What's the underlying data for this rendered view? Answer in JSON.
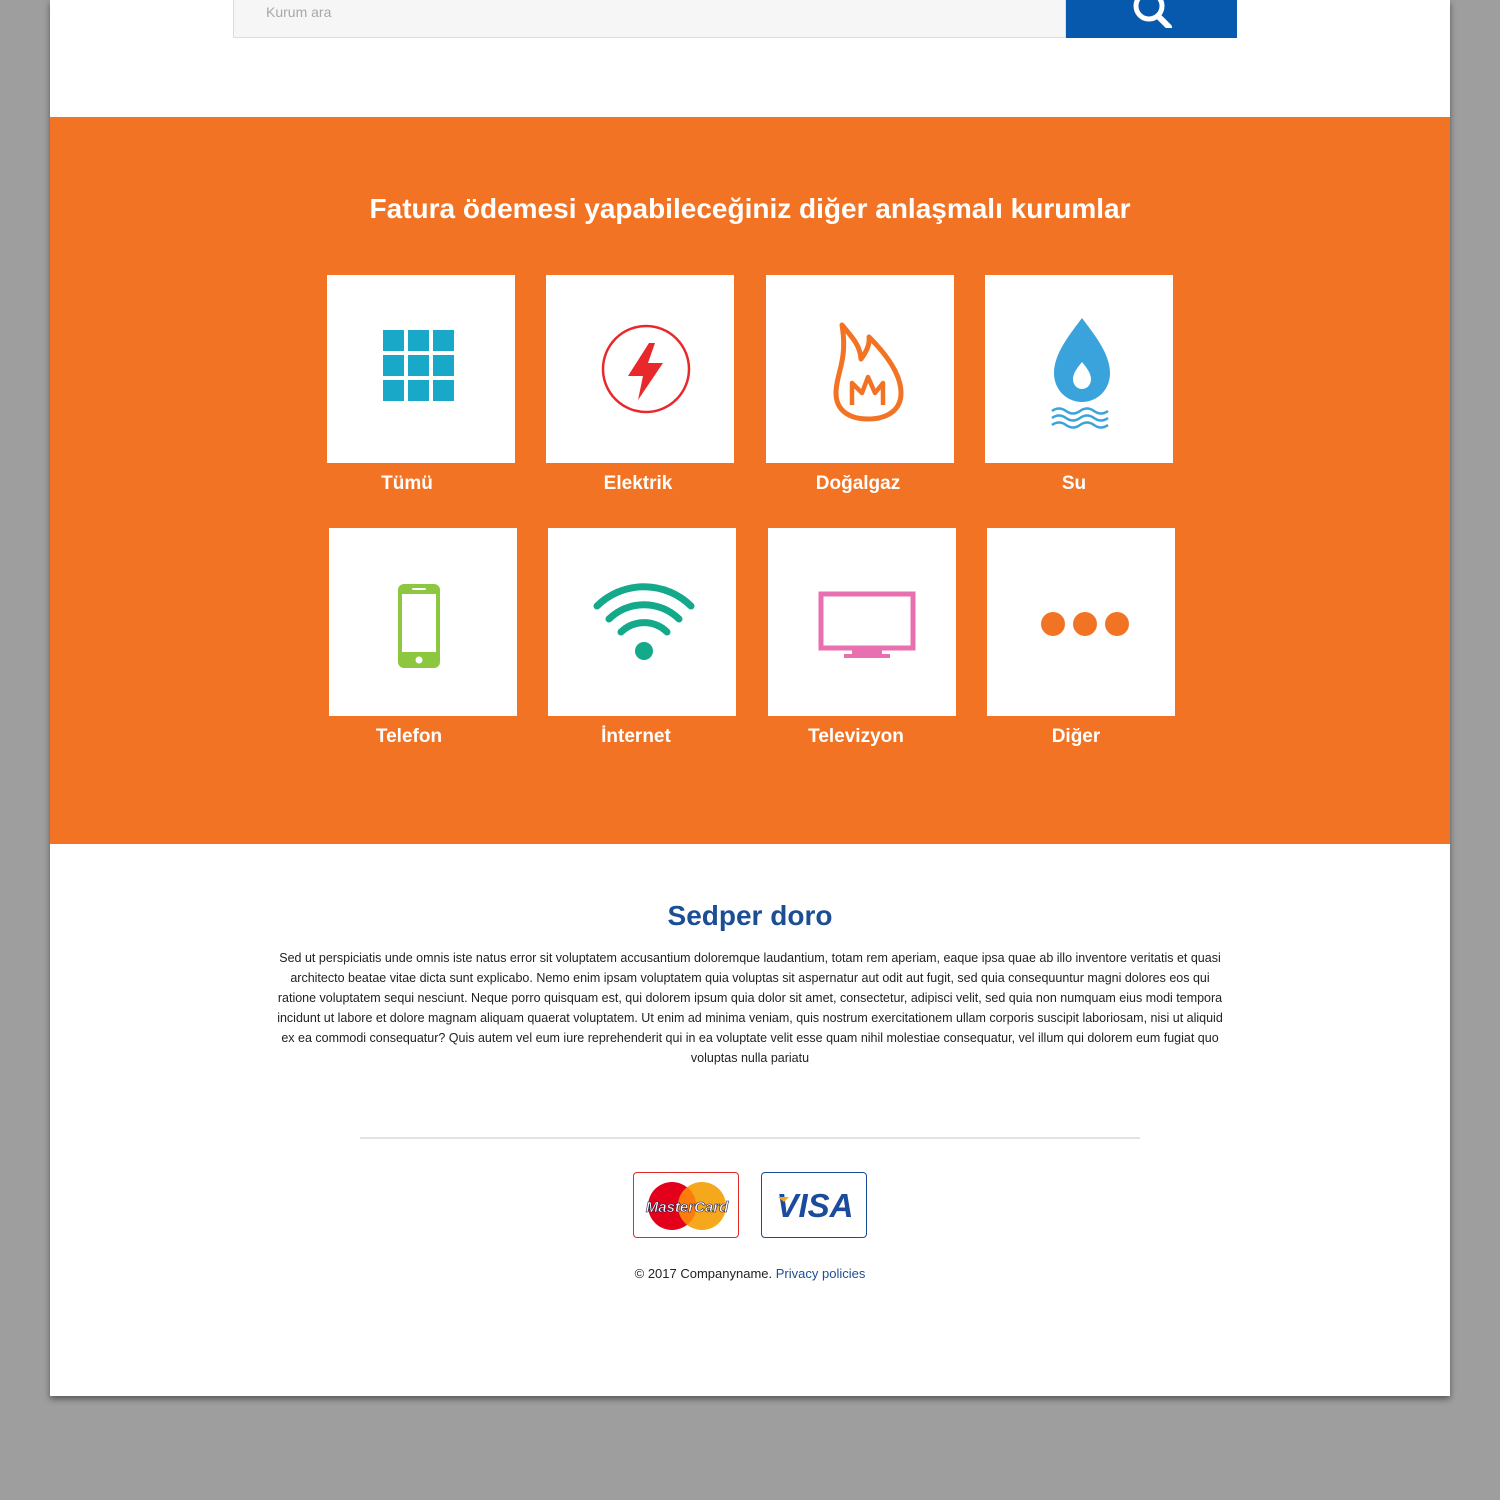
{
  "search": {
    "placeholder": "Kurum ara",
    "button_icon": "search-icon"
  },
  "partners": {
    "title": "Fatura ödemesi yapabileceğiniz diğer anlaşmalı kurumlar",
    "background_color": "#f37324",
    "categories": [
      {
        "label": "Tümü",
        "icon": "grid-icon",
        "color": "#1aa8c9"
      },
      {
        "label": "Elektrik",
        "icon": "lightning-icon",
        "color": "#e8282b"
      },
      {
        "label": "Doğalgaz",
        "icon": "flame-icon",
        "color": "#f37324"
      },
      {
        "label": "Su",
        "icon": "water-drop-icon",
        "color": "#3aa3dc"
      },
      {
        "label": "Telefon",
        "icon": "mobile-phone-icon",
        "color": "#8dc63f"
      },
      {
        "label": "İnternet",
        "icon": "wifi-icon",
        "color": "#14a98b"
      },
      {
        "label": "Televizyon",
        "icon": "tv-icon",
        "color": "#e86fb0"
      },
      {
        "label": "Diğer",
        "icon": "more-dots-icon",
        "color": "#f37324"
      }
    ]
  },
  "about": {
    "title": "Sedper doro",
    "text": "Sed ut perspiciatis unde omnis iste natus error sit voluptatem accusantium doloremque laudantium, totam rem aperiam, eaque ipsa quae ab illo inventore veritatis et quasi architecto beatae vitae dicta sunt explicabo. Nemo enim ipsam voluptatem quia voluptas sit aspernatur aut odit aut fugit, sed quia consequuntur magni dolores eos qui ratione voluptatem sequi nesciunt. Neque porro quisquam est, qui dolorem ipsum quia dolor sit amet, consectetur, adipisci velit, sed quia non numquam eius modi tempora incidunt ut labore et dolore magnam aliquam quaerat voluptatem. Ut enim ad minima veniam, quis nostrum exercitationem ullam corporis suscipit laboriosam, nisi ut aliquid ex ea commodi consequatur? Quis autem vel eum iure reprehenderit qui in ea voluptate velit esse quam nihil molestiae consequatur, vel illum qui dolorem eum fugiat quo voluptas nulla pariatu"
  },
  "payments": {
    "mastercard": "MasterCard",
    "visa": "VISA"
  },
  "footer": {
    "copyright": "© 2017 Companyname.",
    "privacy_link": "Privacy policies"
  },
  "colors": {
    "primary_blue": "#0759ad",
    "heading_blue": "#1c4e94"
  }
}
